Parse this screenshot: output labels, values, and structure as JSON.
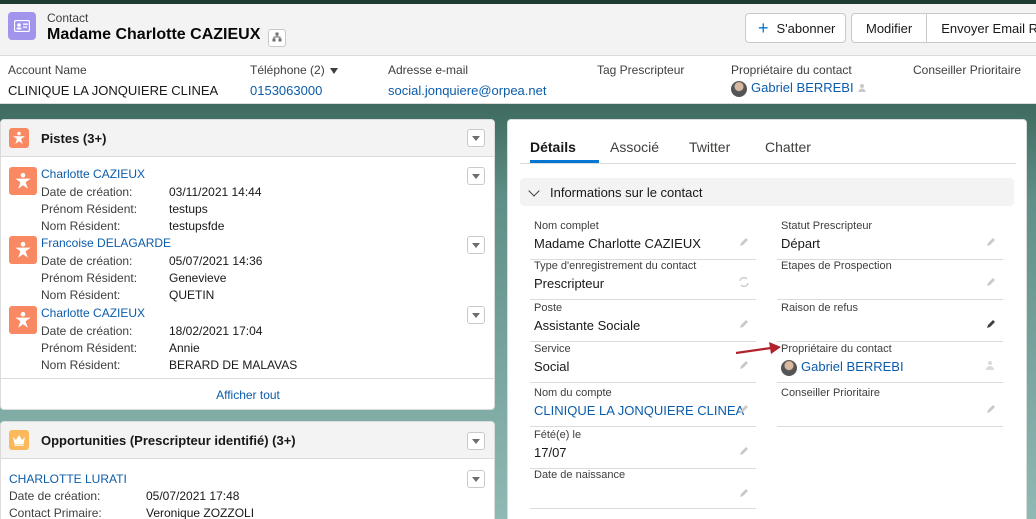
{
  "header": {
    "object_label": "Contact",
    "record_title": "Madame Charlotte CAZIEUX",
    "follow_button": "S'abonner",
    "edit_button": "Modifier",
    "email_button": "Envoyer Email RGPD",
    "highlights": {
      "account_label": "Account Name",
      "account_value": "CLINIQUE LA JONQUIERE CLINEA",
      "phone_label": "Téléphone (2)",
      "phone_value": "0153063000",
      "email_label": "Adresse e-mail",
      "email_value": "social.jonquiere@orpea.net",
      "tag_label": "Tag Prescripteur",
      "owner_label": "Propriétaire du contact",
      "owner_value": "Gabriel BERREBI",
      "advisor_label": "Conseiller Prioritaire"
    }
  },
  "leads_card": {
    "title": "Pistes (3+)",
    "items": [
      {
        "name": "Charlotte CAZIEUX",
        "l1": "Date de création:",
        "v1": "03/11/2021 14:44",
        "l2": "Prénom Résident:",
        "v2": "testups",
        "l3": "Nom Résident:",
        "v3": "testupsfde"
      },
      {
        "name": "Francoise DELAGARDE",
        "l1": "Date de création:",
        "v1": "05/07/2021 14:36",
        "l2": "Prénom Résident:",
        "v2": "Genevieve",
        "l3": "Nom Résident:",
        "v3": "QUETIN"
      },
      {
        "name": "Charlotte CAZIEUX",
        "l1": "Date de création:",
        "v1": "18/02/2021 17:04",
        "l2": "Prénom Résident:",
        "v2": "Annie",
        "l3": "Nom Résident:",
        "v3": "BERARD DE MALAVAS"
      }
    ],
    "show_all": "Afficher tout"
  },
  "opps_card": {
    "title": "Opportunities (Prescripteur identifié) (3+)",
    "item": {
      "name": "CHARLOTTE LURATI",
      "l1": "Date de création:",
      "v1": "05/07/2021 17:48",
      "l2": "Contact Primaire:",
      "v2": "Veronique ZOZZOLI"
    }
  },
  "details": {
    "tabs": [
      "Détails",
      "Associé",
      "Twitter",
      "Chatter"
    ],
    "section_title": "Informations sur le contact",
    "fields_left": [
      {
        "label": "Nom complet",
        "value": "Madame Charlotte CAZIEUX"
      },
      {
        "label": "Type d'enregistrement du contact",
        "value": "Prescripteur"
      },
      {
        "label": "Poste",
        "value": "Assistante Sociale"
      },
      {
        "label": "Service",
        "value": "Social"
      },
      {
        "label": "Nom du compte",
        "value": "CLINIQUE LA JONQUIERE CLINEA"
      },
      {
        "label": "Fété(e) le",
        "value": "17/07"
      },
      {
        "label": "Date de naissance",
        "value": ""
      }
    ],
    "fields_right": [
      {
        "label": "Statut Prescripteur",
        "value": "Départ"
      },
      {
        "label": "Etapes de Prospection",
        "value": ""
      },
      {
        "label": "Raison de refus",
        "value": ""
      },
      {
        "label": "Propriétaire du contact",
        "value": "Gabriel BERREBI"
      },
      {
        "label": "Conseiller Prioritaire",
        "value": ""
      }
    ]
  },
  "colors": {
    "brand_blue": "#0176d3",
    "link_blue": "#0b5cab",
    "contact_icon": "#a094ed",
    "lead_icon": "#f88962",
    "opportunity_icon": "#fcb95b",
    "annotation_arrow": "#b0222c"
  }
}
